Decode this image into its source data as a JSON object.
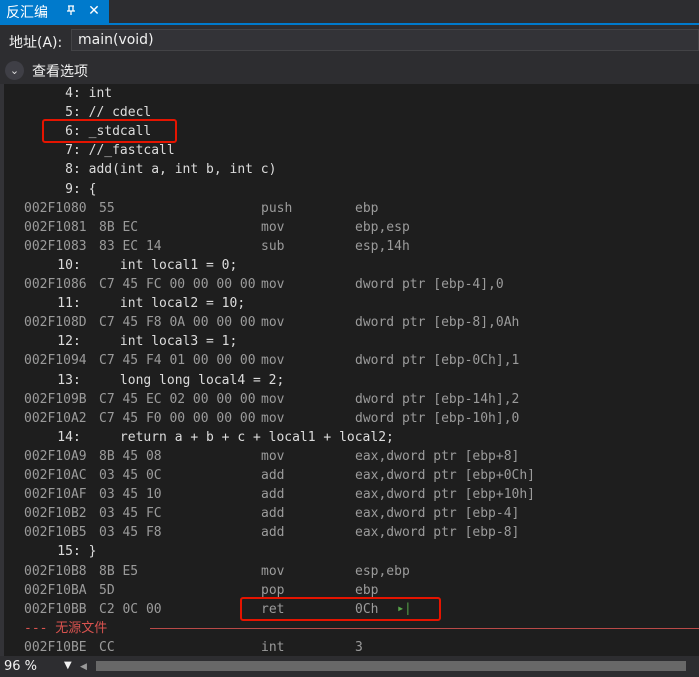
{
  "tab": {
    "title": "反汇编",
    "pin_icon": "pin-icon",
    "close_icon": "close-icon"
  },
  "address": {
    "label": "地址(A):",
    "value": "main(void)"
  },
  "view_options": {
    "label": "查看选项"
  },
  "lines": [
    {
      "kind": "src",
      "text": "     4: int"
    },
    {
      "kind": "src",
      "text": "     5: // cdecl"
    },
    {
      "kind": "src",
      "text": "     6: _stdcall"
    },
    {
      "kind": "src",
      "text": "     7: //_fastcall"
    },
    {
      "kind": "src",
      "text": "     8: add(int a, int b, int c)"
    },
    {
      "kind": "src",
      "text": "     9: {"
    },
    {
      "kind": "asm",
      "addr": "002F1080",
      "bytes": "55",
      "op": "push",
      "args": "ebp"
    },
    {
      "kind": "asm",
      "addr": "002F1081",
      "bytes": "8B EC",
      "op": "mov",
      "args": "ebp,esp"
    },
    {
      "kind": "asm",
      "addr": "002F1083",
      "bytes": "83 EC 14",
      "op": "sub",
      "args": "esp,14h"
    },
    {
      "kind": "src",
      "text": "    10:     int local1 = 0;"
    },
    {
      "kind": "asm",
      "addr": "002F1086",
      "bytes": "C7 45 FC 00 00 00 00",
      "op": "mov",
      "args": "dword ptr [ebp-4],0"
    },
    {
      "kind": "src",
      "text": "    11:     int local2 = 10;"
    },
    {
      "kind": "asm",
      "addr": "002F108D",
      "bytes": "C7 45 F8 0A 00 00 00",
      "op": "mov",
      "args": "dword ptr [ebp-8],0Ah"
    },
    {
      "kind": "src",
      "text": "    12:     int local3 = 1;"
    },
    {
      "kind": "asm",
      "addr": "002F1094",
      "bytes": "C7 45 F4 01 00 00 00",
      "op": "mov",
      "args": "dword ptr [ebp-0Ch],1"
    },
    {
      "kind": "src",
      "text": "    13:     long long local4 = 2;"
    },
    {
      "kind": "asm",
      "addr": "002F109B",
      "bytes": "C7 45 EC 02 00 00 00",
      "op": "mov",
      "args": "dword ptr [ebp-14h],2"
    },
    {
      "kind": "asm",
      "addr": "002F10A2",
      "bytes": "C7 45 F0 00 00 00 00",
      "op": "mov",
      "args": "dword ptr [ebp-10h],0"
    },
    {
      "kind": "src",
      "text": "    14:     return a + b + c + local1 + local2;"
    },
    {
      "kind": "asm",
      "addr": "002F10A9",
      "bytes": "8B 45 08",
      "op": "mov",
      "args": "eax,dword ptr [ebp+8]"
    },
    {
      "kind": "asm",
      "addr": "002F10AC",
      "bytes": "03 45 0C",
      "op": "add",
      "args": "eax,dword ptr [ebp+0Ch]"
    },
    {
      "kind": "asm",
      "addr": "002F10AF",
      "bytes": "03 45 10",
      "op": "add",
      "args": "eax,dword ptr [ebp+10h]"
    },
    {
      "kind": "asm",
      "addr": "002F10B2",
      "bytes": "03 45 FC",
      "op": "add",
      "args": "eax,dword ptr [ebp-4]"
    },
    {
      "kind": "asm",
      "addr": "002F10B5",
      "bytes": "03 45 F8",
      "op": "add",
      "args": "eax,dword ptr [ebp-8]"
    },
    {
      "kind": "src",
      "text": "    15: }"
    },
    {
      "kind": "asm",
      "addr": "002F10B8",
      "bytes": "8B E5",
      "op": "mov",
      "args": "esp,ebp"
    },
    {
      "kind": "asm",
      "addr": "002F10BA",
      "bytes": "5D",
      "op": "pop",
      "args": "ebp"
    },
    {
      "kind": "asm",
      "addr": "002F10BB",
      "bytes": "C2 0C 00",
      "op": "ret",
      "args": "0Ch"
    },
    {
      "kind": "sep",
      "text": "--- 无源文件"
    },
    {
      "kind": "asm",
      "addr": "002F10BE",
      "bytes": "CC",
      "op": "int",
      "args": "3"
    }
  ],
  "run_to_cursor_glyph": "▸|",
  "status": {
    "zoom": "96 %",
    "dropdown_icon": "chevron-down-icon"
  },
  "colors": {
    "accent": "#007acc",
    "highlight": "#e51400",
    "separator": "#d9534f"
  }
}
